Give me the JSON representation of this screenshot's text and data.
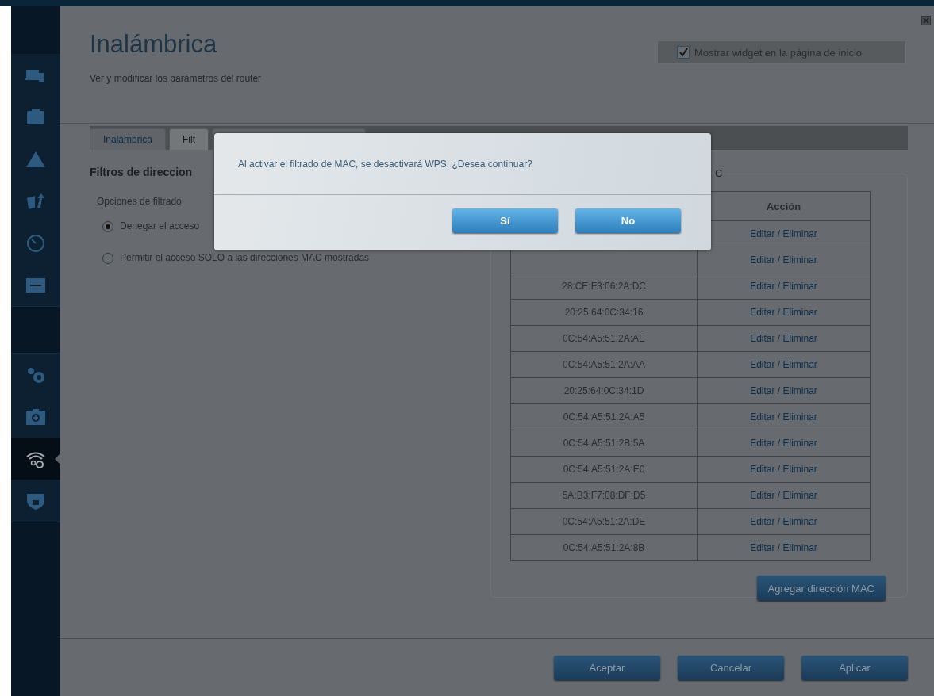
{
  "sidebar": {
    "sections": [
      {
        "items": [
          {
            "selected": false
          },
          {
            "selected": false
          },
          {
            "selected": false
          },
          {
            "selected": false
          },
          {
            "selected": false
          },
          {
            "selected": false
          }
        ]
      },
      {
        "items": [
          {
            "selected": false
          },
          {
            "selected": false
          },
          {
            "selected": true
          },
          {
            "selected": false
          }
        ]
      }
    ]
  },
  "header": {
    "title": "Inalámbrica",
    "subtitle": "Ver y modificar los parámetros del router",
    "widget_checkbox": {
      "label": "Mostrar widget en la página de inicio",
      "checked": true
    }
  },
  "tabs": [
    {
      "label": "Inalámbrica",
      "selected": false
    },
    {
      "label": "Filt",
      "selected": true
    },
    {
      "selected": false
    }
  ],
  "filters": {
    "heading": "Filtros de direccion",
    "options_label": "Opciones de filtrado",
    "options": [
      {
        "label": "Denegar el acceso",
        "selected": true
      },
      {
        "label": "Permitir el acceso SOLO a las direcciones MAC mostradas",
        "selected": false
      }
    ]
  },
  "mac_list": {
    "legend": "C",
    "columns": [
      "Acción"
    ],
    "rows": [
      {
        "action": "Editar / Eliminar"
      },
      {
        "action": "Editar / Eliminar"
      },
      {
        "mac": "28:CE:F3:06:2A:DC",
        "action": "Editar / Eliminar"
      },
      {
        "mac": "20:25:64:0C:34:16",
        "action": "Editar / Eliminar"
      },
      {
        "mac": "0C:54:A5:51:2A:AE",
        "action": "Editar / Eliminar"
      },
      {
        "mac": "0C:54:A5:51:2A:AA",
        "action": "Editar / Eliminar"
      },
      {
        "mac": "20:25:64:0C:34:1D",
        "action": "Editar / Eliminar"
      },
      {
        "mac": "0C:54:A5:51:2A:A5",
        "action": "Editar / Eliminar"
      },
      {
        "mac": "0C:54:A5:51:2B:5A",
        "action": "Editar / Eliminar"
      },
      {
        "mac": "0C:54:A5:51:2A:E0",
        "action": "Editar / Eliminar"
      },
      {
        "mac": "5A:B3:F7:08:DF:D5",
        "action": "Editar / Eliminar"
      },
      {
        "mac": "0C:54:A5:51:2A:DE",
        "action": "Editar / Eliminar"
      },
      {
        "mac": "0C:54:A5:51:2A:8B",
        "action": "Editar / Eliminar"
      }
    ],
    "add_button": "Agregar dirección MAC"
  },
  "footer_buttons": [
    "Aceptar",
    "Cancelar",
    "Aplicar"
  ],
  "dialog": {
    "message": "Al activar el filtrado de MAC, se desactivará WPS. ¿Desea continuar?",
    "buttons": [
      "Sí",
      "No"
    ]
  }
}
